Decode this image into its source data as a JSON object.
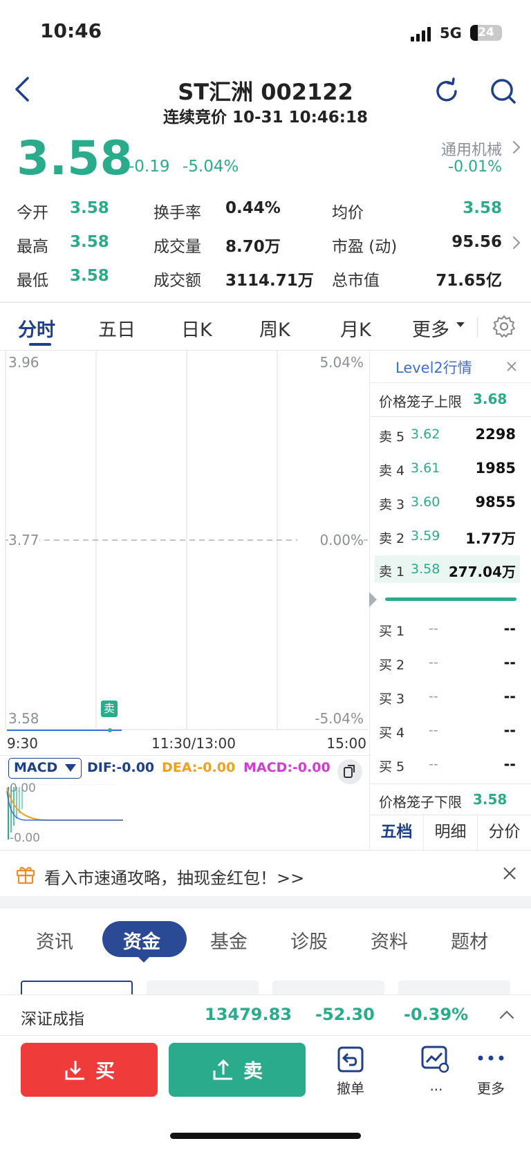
{
  "status": {
    "time": "10:46",
    "network": "5G",
    "battery": "24"
  },
  "header": {
    "title": "ST汇洲 002122",
    "subtitle": "连续竞价 10-31 10:46:18"
  },
  "quote": {
    "price": "3.58",
    "change": "-0.19",
    "change_pct": "-5.04%",
    "industry": "通用机械",
    "industry_pct": "-0.01%"
  },
  "stats": [
    {
      "label": "今开",
      "value": "3.58"
    },
    {
      "label": "换手率",
      "value": "0.44%"
    },
    {
      "label": "均价",
      "value": "3.58"
    },
    {
      "label": "最高",
      "value": "3.58"
    },
    {
      "label": "成交量",
      "value": "8.70万"
    },
    {
      "label": "市盈 (动)",
      "value": "95.56"
    },
    {
      "label": "最低",
      "value": "3.58"
    },
    {
      "label": "成交额",
      "value": "3114.71万"
    },
    {
      "label": "总市值",
      "value": "71.65亿"
    }
  ],
  "chart_tabs": [
    "分时",
    "五日",
    "日K",
    "周K",
    "月K",
    "更多"
  ],
  "chart": {
    "y_top": "3.96",
    "y_mid": "3.77",
    "y_bottom": "3.58",
    "pct_top": "5.04%",
    "pct_mid": "0.00%",
    "pct_bottom": "-5.04%",
    "x_start": "9:30",
    "x_mid": "11:30/13:00",
    "x_end": "15:00",
    "sell_marker": "卖",
    "macd_select": "MACD",
    "dif": "DIF:-0.00",
    "dea": "DEA:-0.00",
    "macd": "MACD:-0.00",
    "macd_top": "0.00",
    "macd_bottom": "-0.00"
  },
  "orderbook": {
    "title": "Level2行情",
    "upper_limit_label": "价格笼子上限",
    "upper_limit": "3.68",
    "lower_limit_label": "价格笼子下限",
    "lower_limit": "3.58",
    "sells": [
      {
        "label": "卖 5",
        "price": "3.62",
        "vol": "2298"
      },
      {
        "label": "卖 4",
        "price": "3.61",
        "vol": "1985"
      },
      {
        "label": "卖 3",
        "price": "3.60",
        "vol": "9855"
      },
      {
        "label": "卖 2",
        "price": "3.59",
        "vol": "1.77万"
      },
      {
        "label": "卖 1",
        "price": "3.58",
        "vol": "277.04万"
      }
    ],
    "buys": [
      {
        "label": "买 1",
        "price": "--",
        "vol": "--"
      },
      {
        "label": "买 2",
        "price": "--",
        "vol": "--"
      },
      {
        "label": "买 3",
        "price": "--",
        "vol": "--"
      },
      {
        "label": "买 4",
        "price": "--",
        "vol": "--"
      },
      {
        "label": "买 5",
        "price": "--",
        "vol": "--"
      }
    ],
    "tabs": [
      "五档",
      "明细",
      "分价"
    ]
  },
  "promo": {
    "text": "看入市速通攻略，抽现金红包！>>"
  },
  "info_tabs": [
    "资讯",
    "资金",
    "基金",
    "诊股",
    "资料",
    "题材"
  ],
  "index": {
    "name": "深证成指",
    "value": "13479.83",
    "change": "-52.30",
    "pct": "-0.39%"
  },
  "actions": {
    "buy": "买",
    "sell": "卖",
    "cancel": "撤单",
    "more_dots": "...",
    "more": "更多"
  },
  "colors": {
    "green": "#2aab8c",
    "red": "#f03b3b",
    "navy": "#1e3f8a",
    "blue": "#3a6fd8"
  }
}
